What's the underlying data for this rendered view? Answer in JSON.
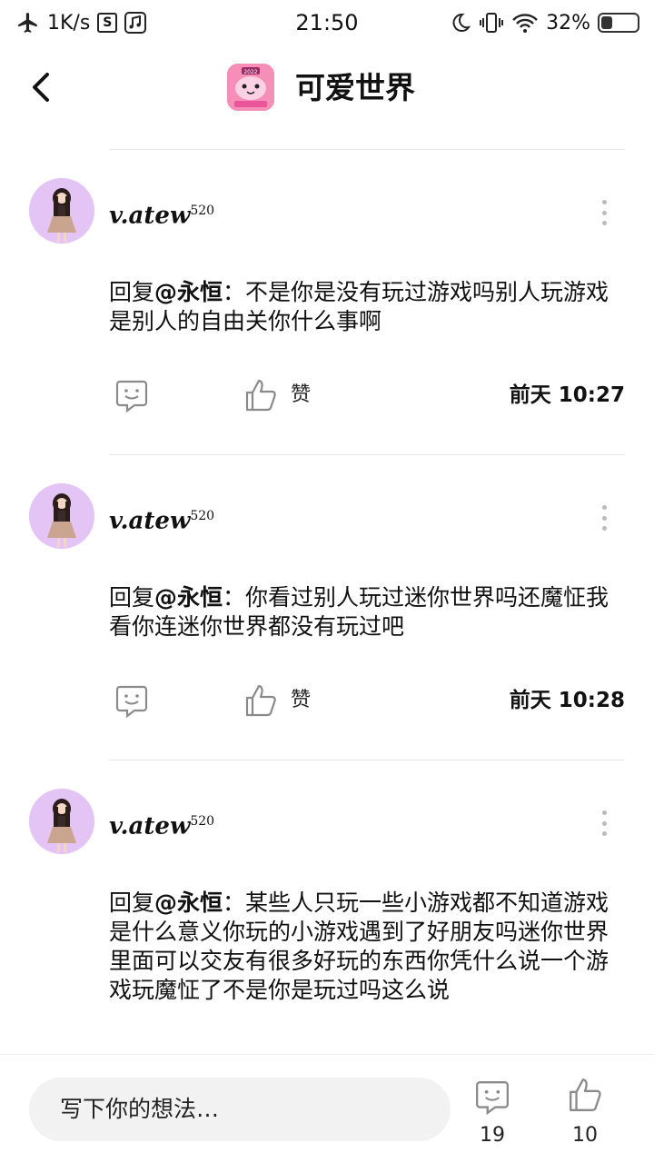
{
  "status_bar": {
    "speed": "1K/s",
    "time": "21:50",
    "battery": "32%",
    "battery_level": 0.32,
    "icons": [
      "airplane-icon",
      "sim-icon",
      "music-icon",
      "moon-icon",
      "vibrate-icon",
      "wifi-icon",
      "battery-icon"
    ]
  },
  "header": {
    "title": "可爱世界",
    "app_icon_year": "2022",
    "app_icon_color": "#f58fb7"
  },
  "comments": [
    {
      "username": "v.atew",
      "username_sup": "520",
      "reply_prefix": "回复",
      "mention": "@永恒",
      "separator": "：",
      "text": "不是你是没有玩过游戏吗别人玩游戏是别人的自由关你什么事啊",
      "like_label": "赞",
      "time": "前天 10:27"
    },
    {
      "username": "v.atew",
      "username_sup": "520",
      "reply_prefix": "回复",
      "mention": "@永恒",
      "separator": "：",
      "text": "你看过别人玩过迷你世界吗还魔怔我看你连迷你世界都没有玩过吧",
      "like_label": "赞",
      "time": "前天 10:28"
    },
    {
      "username": "v.atew",
      "username_sup": "520",
      "reply_prefix": "回复",
      "mention": "@永恒",
      "separator": "：",
      "text": "某些人只玩一些小游戏都不知道游戏是什么意义你玩的小游戏遇到了好朋友吗迷你世界里面可以交友有很多好玩的东西你凭什么说一个游戏玩魔怔了不是你是玩过吗这么说"
    }
  ],
  "bottom_bar": {
    "input_placeholder": "写下你的想法…",
    "reply_count": "19",
    "like_count": "10"
  }
}
